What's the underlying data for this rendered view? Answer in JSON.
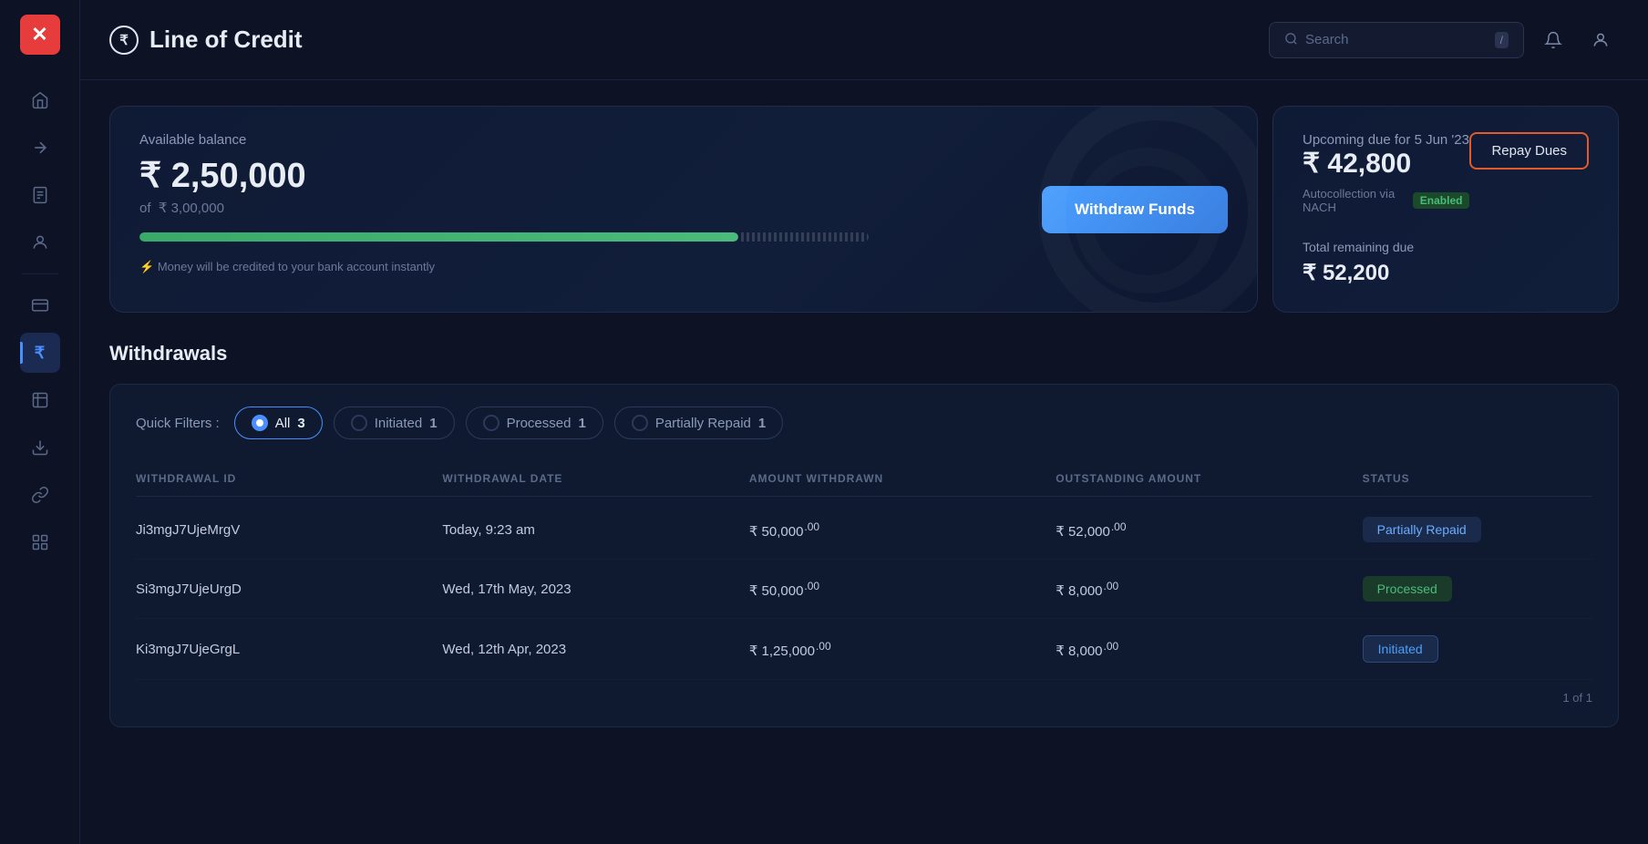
{
  "sidebar": {
    "logo": "✕",
    "icons": [
      {
        "name": "home-icon",
        "symbol": "⌂",
        "active": false
      },
      {
        "name": "arrow-icon",
        "symbol": "↗",
        "active": false
      },
      {
        "name": "document-icon",
        "symbol": "☰",
        "active": false
      },
      {
        "name": "user-icon",
        "symbol": "👤",
        "active": false
      },
      {
        "name": "card-icon",
        "symbol": "▭",
        "active": false
      },
      {
        "name": "rupee-icon",
        "symbol": "₹",
        "active": true
      },
      {
        "name": "list-icon",
        "symbol": "≡",
        "active": false
      },
      {
        "name": "download-icon",
        "symbol": "↓",
        "active": false
      },
      {
        "name": "link-icon",
        "symbol": "⛓",
        "active": false
      },
      {
        "name": "grid-icon",
        "symbol": "⊞",
        "active": false
      }
    ]
  },
  "header": {
    "rupee_symbol": "₹",
    "title": "Line of Credit",
    "search_placeholder": "Search",
    "search_shortcut": "/"
  },
  "balance_card": {
    "label": "Available balance",
    "amount": "₹ 2,50,000",
    "of_label": "of",
    "total": "₹ 3,00,000",
    "progress_pct": 83,
    "instant_note": "Money will be credited to your bank account instantly",
    "bolt": "⚡",
    "withdraw_btn_label": "Withdraw Funds"
  },
  "due_card": {
    "date_label": "Upcoming due for 5 Jun '23",
    "amount": "₹ 42,800",
    "nach_label": "Autocollection via NACH",
    "nach_status": "Enabled",
    "total_remaining_label": "Total remaining due",
    "total_remaining": "₹ 52,200",
    "repay_btn_label": "Repay Dues"
  },
  "withdrawals": {
    "section_title": "Withdrawals",
    "filters_label": "Quick Filters :",
    "filters": [
      {
        "id": "all",
        "label": "All",
        "count": "3",
        "active": true
      },
      {
        "id": "initiated",
        "label": "Initiated",
        "count": "1",
        "active": false
      },
      {
        "id": "processed",
        "label": "Processed",
        "count": "1",
        "active": false
      },
      {
        "id": "partially-repaid",
        "label": "Partially Repaid",
        "count": "1",
        "active": false
      }
    ],
    "table_headers": [
      "WITHDRAWAL ID",
      "WITHDRAWAL DATE",
      "AMOUNT WITHDRAWN",
      "OUTSTANDING AMOUNT",
      "STATUS"
    ],
    "rows": [
      {
        "id": "Ji3mgJ7UjeMrgV",
        "date": "Today, 9:23 am",
        "amount": "₹ 50,000",
        "amount_cents": ".00",
        "outstanding": "₹ 52,000",
        "outstanding_cents": ".00",
        "status": "Partially Repaid",
        "status_class": "partially-repaid"
      },
      {
        "id": "Si3mgJ7UjeUrgD",
        "date": "Wed, 17th May, 2023",
        "amount": "₹ 50,000",
        "amount_cents": ".00",
        "outstanding": "₹ 8,000",
        "outstanding_cents": ".00",
        "status": "Processed",
        "status_class": "processed"
      },
      {
        "id": "Ki3mgJ7UjeGrgL",
        "date": "Wed, 12th Apr, 2023",
        "amount": "₹ 1,25,000",
        "amount_cents": ".00",
        "outstanding": "₹ 8,000",
        "outstanding_cents": ".00",
        "status": "Initiated",
        "status_class": "initiated"
      }
    ],
    "pagination": "1 of 1"
  }
}
